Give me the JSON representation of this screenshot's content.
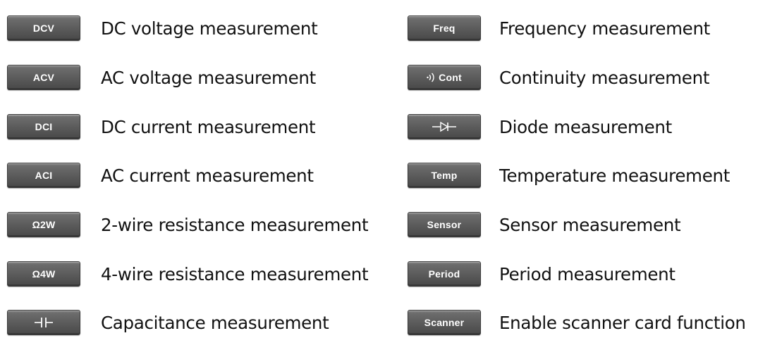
{
  "left_column": [
    {
      "key_label": "DCV",
      "description": "DC voltage measurement"
    },
    {
      "key_label": "ACV",
      "description": "AC voltage measurement"
    },
    {
      "key_label": "DCI",
      "description": "DC current measurement"
    },
    {
      "key_label": "ACI",
      "description": "AC current measurement"
    },
    {
      "key_label": "Ω2W",
      "description": "2-wire resistance measurement"
    },
    {
      "key_label": "Ω4W",
      "description": "4-wire resistance measurement"
    },
    {
      "key_icon": "capacitor-icon",
      "description": "Capacitance measurement"
    }
  ],
  "right_column": [
    {
      "key_label": "Freq",
      "description": "Frequency measurement"
    },
    {
      "key_icon": "speaker-icon",
      "key_label": "Cont",
      "description": "Continuity measurement"
    },
    {
      "key_icon": "diode-icon",
      "description": "Diode measurement"
    },
    {
      "key_label": "Temp",
      "description": "Temperature measurement"
    },
    {
      "key_label": "Sensor",
      "description": "Sensor measurement"
    },
    {
      "key_label": "Period",
      "description": "Period measurement"
    },
    {
      "key_label": "Scanner",
      "description": "Enable scanner card function"
    }
  ],
  "colors": {
    "key_face": "#5a5a5a",
    "key_text": "#ffffff",
    "description_text": "#111111"
  }
}
